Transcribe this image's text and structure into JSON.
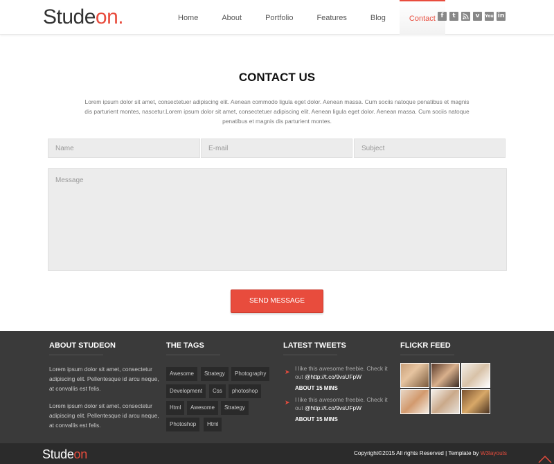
{
  "header": {
    "logo_main": "Stude",
    "logo_accent": "on",
    "logo_dot": ".",
    "nav": [
      "Home",
      "About",
      "Portfolio",
      "Features",
      "Blog",
      "Contact"
    ],
    "active_nav": "Contact",
    "socials": [
      "facebook-icon",
      "twitter-icon",
      "rss-icon",
      "vimeo-icon",
      "youtube-icon",
      "linkedin-icon"
    ]
  },
  "contact": {
    "title": "CONTACT US",
    "text": "Lorem ipsum dolor sit amet, consectetuer adipiscing elit. Aenean commodo ligula eget dolor. Aenean massa. Cum sociis natoque penatibus et magnis dis parturient montes, nascetur.Lorem ipsum dolor sit amet, consectetuer adipiscing elit. Aenean ligula eget dolor. Aenean massa. Cum sociis natoque penatibus et magnis dis parturient montes.",
    "name_placeholder": "Name",
    "email_placeholder": "E-mail",
    "subject_placeholder": "Subject",
    "message_placeholder": "Message",
    "send_label": "SEND MESSAGE"
  },
  "footer": {
    "about_title": "ABOUT STUDEON",
    "about_p1": "Lorem ipsum dolor sit amet, consectetur adipiscing elit. Pellentesque id arcu neque, at convallis est felis.",
    "about_p2": "Lorem ipsum dolor sit amet, consectetur adipiscing elit. Pellentesque id arcu neque, at convallis est felis.",
    "tags_title": "THE TAGS",
    "tags": [
      "Awesome",
      "Strategy",
      "Photography",
      "Development",
      "Css",
      "photoshop",
      "Html",
      "Awesome",
      "Strategy",
      "Photoshop",
      "Html"
    ],
    "tweets_title": "LATEST TWEETS",
    "tweets": [
      {
        "text": "I like this awesome freebie. Check it out ",
        "link": "@http://t.co/9vsUFpW",
        "time": "ABOUT 15 MINS"
      },
      {
        "text": "I like this awesome freebie. Check it out ",
        "link": "@http://t.co/9vsUFpW",
        "time": "ABOUT 15 MINS"
      }
    ],
    "flickr_title": "FLICKR FEED"
  },
  "bottom": {
    "logo_main": "Stude",
    "logo_accent": "on",
    "copyright": "Copyright©2015 All rights Reserved | Template by ",
    "brand": "W3layouts"
  },
  "colors": {
    "accent": "#e84c3d",
    "footer_bg": "#3a3a3a",
    "bottom_bg": "#2b2b2b"
  }
}
